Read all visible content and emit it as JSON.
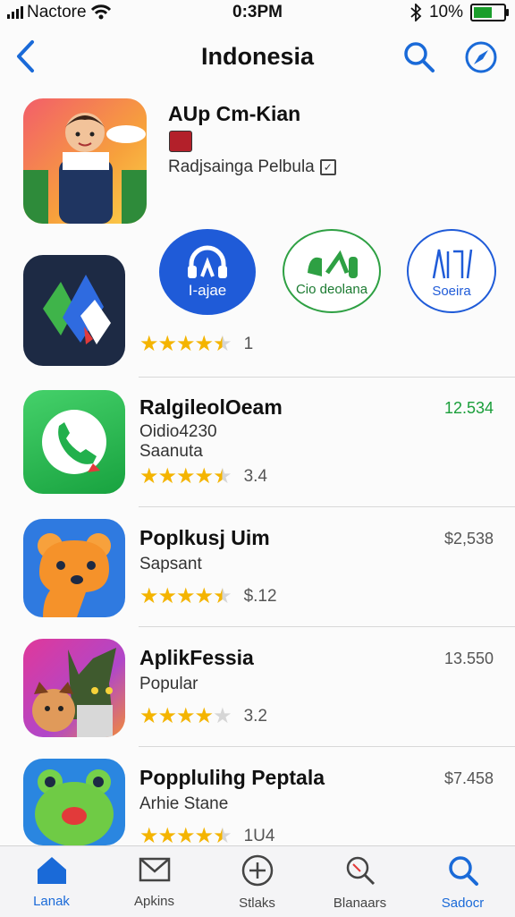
{
  "status_bar": {
    "carrier": "Nactore",
    "time": "0:3PM",
    "battery": "10%",
    "battery_level": 0.7
  },
  "header": {
    "title": "Indonesia"
  },
  "featured": {
    "name": "AUp Cm-Kian",
    "subtitle": "Radjsainga Pelbula"
  },
  "featured_row": {
    "rating_value": "1",
    "stars": 4.5,
    "mini_apps": [
      {
        "label": "I-ajae"
      },
      {
        "label": "Cio deolana"
      },
      {
        "label": "Soeira"
      }
    ]
  },
  "apps": [
    {
      "name": "RalgileolOeam",
      "line1": "Oidio4230",
      "line2": "Saanuta",
      "rating": "3.4",
      "stars": 4.5,
      "price": "12.534",
      "price_color": "#1a9e3a"
    },
    {
      "name": "Poplkusj Uim",
      "line1": "Sapsant",
      "rating": "$.12",
      "stars": 4.5,
      "price": "$2,538",
      "price_color": "#555555"
    },
    {
      "name": "AplikFessia",
      "line1": "Popular",
      "rating": "3.2",
      "stars": 4,
      "price": "13.550",
      "price_color": "#555555"
    },
    {
      "name": "Popplulihg Peptala",
      "line1": "Arhie Stane",
      "rating": "1U4",
      "stars": 4.5,
      "price": "$7.458",
      "price_color": "#555555"
    }
  ],
  "tabs": [
    {
      "label": "Lanak",
      "icon": "home-icon",
      "active": true
    },
    {
      "label": "Apkins",
      "icon": "mail-icon",
      "active": false
    },
    {
      "label": "Stlaks",
      "icon": "plus-circle-icon",
      "active": false
    },
    {
      "label": "Blanaars",
      "icon": "search-icon",
      "active": false
    },
    {
      "label": "Sadocr",
      "icon": "search-icon",
      "active": true
    }
  ],
  "colors": {
    "accent": "#1a6ad8",
    "star": "#f4b400"
  }
}
